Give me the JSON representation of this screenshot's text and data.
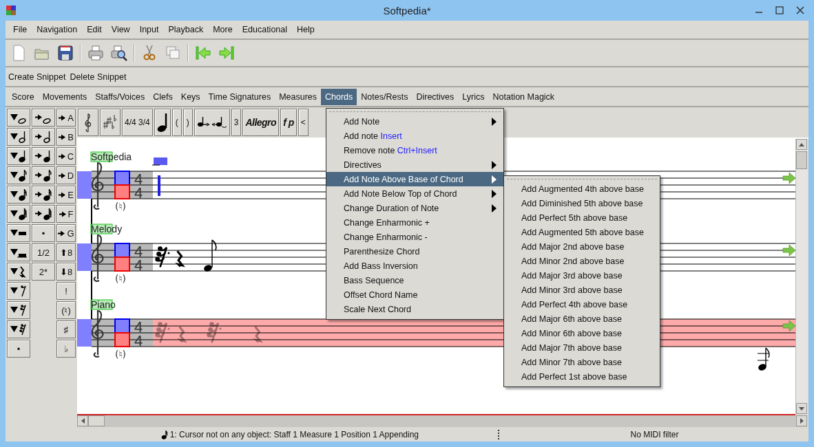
{
  "window": {
    "title": "Softpedia*"
  },
  "menu_bar": [
    "File",
    "Navigation",
    "Edit",
    "View",
    "Input",
    "Playback",
    "More",
    "Educational",
    "Help"
  ],
  "snippet_bar": [
    "Create Snippet",
    "Delete Snippet"
  ],
  "tabs": [
    {
      "label": "Score",
      "selected": false
    },
    {
      "label": "Movements",
      "selected": false
    },
    {
      "label": "Staffs/Voices",
      "selected": false
    },
    {
      "label": "Clefs",
      "selected": false
    },
    {
      "label": "Keys",
      "selected": false
    },
    {
      "label": "Time Signatures",
      "selected": false
    },
    {
      "label": "Measures",
      "selected": false
    },
    {
      "label": "Chords",
      "selected": true
    },
    {
      "label": "Notes/Rests",
      "selected": false
    },
    {
      "label": "Directives",
      "selected": false
    },
    {
      "label": "Lyrics",
      "selected": false
    },
    {
      "label": "Notation Magick",
      "selected": false
    }
  ],
  "palette": {
    "columns": [
      [
        {
          "kind": "insert_note_whole"
        },
        {
          "kind": "insert_note_half"
        },
        {
          "kind": "insert_note_quarter"
        },
        {
          "kind": "insert_note_eighth"
        },
        {
          "kind": "insert_note_sixteenth"
        },
        {
          "kind": "insert_note_thirtysecond"
        },
        {
          "kind": "insert_rest_whole"
        },
        {
          "kind": "insert_rest_half"
        },
        {
          "kind": "insert_rest_quarter"
        },
        {
          "kind": "insert_rest_eighth"
        },
        {
          "kind": "insert_rest_sixteenth"
        },
        {
          "kind": "insert_rest_thirtysecond"
        },
        {
          "kind": "text",
          "label": "•"
        }
      ],
      [
        {
          "kind": "append_note_whole"
        },
        {
          "kind": "append_note_half"
        },
        {
          "kind": "append_note_quarter"
        },
        {
          "kind": "append_note_eighth"
        },
        {
          "kind": "append_note_sixteenth"
        },
        {
          "kind": "append_note_thirtysecond"
        },
        {
          "kind": "text",
          "label": "•"
        },
        {
          "kind": "text",
          "label": "1/2"
        },
        {
          "kind": "text",
          "label": "2*"
        }
      ],
      [
        {
          "kind": "append_text",
          "label": "A"
        },
        {
          "kind": "append_text",
          "label": "B"
        },
        {
          "kind": "append_text",
          "label": "C"
        },
        {
          "kind": "append_text",
          "label": "D"
        },
        {
          "kind": "append_text",
          "label": "E"
        },
        {
          "kind": "append_text",
          "label": "F"
        },
        {
          "kind": "append_text",
          "label": "G"
        },
        {
          "kind": "text",
          "label": "⬆8"
        },
        {
          "kind": "text",
          "label": "⬇8"
        },
        {
          "kind": "text",
          "label": "!"
        },
        {
          "kind": "text",
          "label": "(♮)"
        },
        {
          "kind": "text",
          "label": "♯"
        },
        {
          "kind": "text",
          "label": "♭"
        }
      ]
    ]
  },
  "music_toolbar": [
    {
      "kind": "clef"
    },
    {
      "kind": "key_signature"
    },
    {
      "kind": "text",
      "label": "4/4 3/4"
    },
    {
      "kind": "note"
    },
    {
      "kind": "text",
      "label": "("
    },
    {
      "kind": "text",
      "label": ")"
    },
    {
      "kind": "tie"
    },
    {
      "kind": "text",
      "label": "3"
    },
    {
      "kind": "styled",
      "label": "Allegro"
    },
    {
      "kind": "styled",
      "label": "f p"
    },
    {
      "kind": "text",
      "label": "<"
    }
  ],
  "staves": [
    {
      "name": "Softpedia",
      "kind": "cursor",
      "highlighted": false,
      "time_signature": [
        "4",
        "4"
      ],
      "key_mark": "(♮)"
    },
    {
      "name": "Melody",
      "kind": "melody",
      "highlighted": false,
      "time_signature": [
        "4",
        "4"
      ],
      "key_mark": "(♮)"
    },
    {
      "name": "Piano",
      "kind": "faded",
      "highlighted": true,
      "time_signature": [
        "4",
        "4"
      ],
      "key_mark": "(♮)"
    }
  ],
  "chords_menu": {
    "items": [
      {
        "label": "Add Note",
        "submenu": true,
        "selected": false
      },
      {
        "label": "Add note",
        "shortcut": "Insert",
        "submenu": false,
        "selected": false
      },
      {
        "label": "Remove note",
        "shortcut": "Ctrl+Insert",
        "submenu": false,
        "selected": false
      },
      {
        "label": "Directives",
        "submenu": true,
        "selected": false
      },
      {
        "label": "Add Note Above Base of Chord",
        "submenu": true,
        "selected": true
      },
      {
        "label": "Add Note Below Top of Chord",
        "submenu": true,
        "selected": false
      },
      {
        "label": "Change Duration of Note",
        "submenu": true,
        "selected": false
      },
      {
        "label": "Change Enharmonic +",
        "submenu": false,
        "selected": false
      },
      {
        "label": "Change Enharmonic -",
        "submenu": false,
        "selected": false
      },
      {
        "label": "Parenthesize Chord",
        "submenu": false,
        "selected": false
      },
      {
        "label": "Add Bass Inversion",
        "submenu": false,
        "selected": false
      },
      {
        "label": "Bass Sequence",
        "submenu": false,
        "selected": false
      },
      {
        "label": "Offset Chord Name",
        "submenu": false,
        "selected": false
      },
      {
        "label": "Scale Next Chord",
        "submenu": false,
        "selected": false
      }
    ]
  },
  "submenu": {
    "items": [
      "Add Augmented 4th above base",
      "Add Diminished 5th above base",
      "Add Perfect 5th above base",
      "Add Augmented 5th above base",
      "Add Major 2nd above base",
      "Add Minor 2nd above base",
      "Add Major 3rd above base",
      "Add Minor 3rd above base",
      "Add Perfect 4th above base",
      "Add Major 6th above base",
      "Add Minor 6th above base",
      "Add Major 7th above base",
      "Add Minor 7th above base",
      "Add Perfect 1st above base"
    ]
  },
  "status_bar": {
    "message": "1: Cursor not on any object:  Staff 1 Measure 1 Position 1 Appending",
    "midi": "No MIDI filter"
  }
}
